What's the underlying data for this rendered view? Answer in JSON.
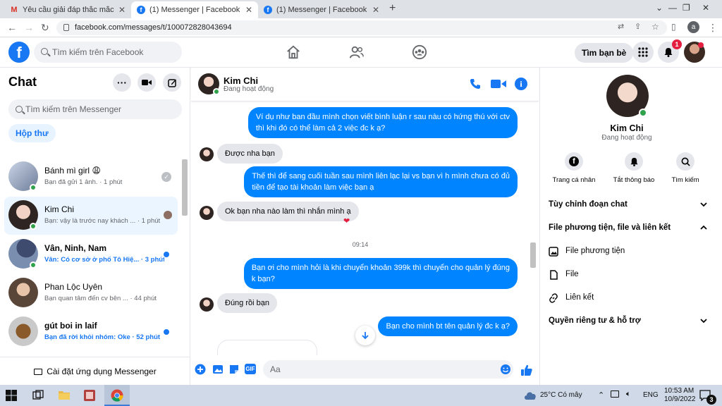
{
  "browser": {
    "tabs": [
      {
        "title": "Yêu cầu giải đáp thắc mắc - anhth",
        "icon": "gmail-icon",
        "active": false
      },
      {
        "title": "(1) Messenger | Facebook",
        "icon": "facebook-icon",
        "active": true
      },
      {
        "title": "(1) Messenger | Facebook",
        "icon": "facebook-icon",
        "active": false
      }
    ],
    "new_tab": "+",
    "url": "facebook.com/messages/t/100072828043694",
    "profile_initial": "a"
  },
  "fb_header": {
    "logo": "f",
    "search_placeholder": "Tìm kiếm trên Facebook",
    "find_friends": "Tìm bạn bè",
    "notification_count": "1"
  },
  "chats_panel": {
    "title": "Chat",
    "search_placeholder": "Tìm kiếm trên Messenger",
    "filter": "Hộp thư",
    "conversations": [
      {
        "name": "Bánh mì girl 😩",
        "preview": "Bạn đã gửi 1 ảnh.",
        "time": "1 phút",
        "selected": false,
        "unread": false,
        "online": true
      },
      {
        "name": "Kim Chi",
        "preview": "Bạn: vậy là trước nay khách ...",
        "time": "1 phút",
        "selected": true,
        "unread": false,
        "online": true
      },
      {
        "name": "Vân, Ninh, Nam",
        "preview": "Vân: Có cơ sở ở phố Tô Hiệ...",
        "time": "3 phút",
        "selected": false,
        "unread": true,
        "online": true
      },
      {
        "name": "Phan Lộc Uyên",
        "preview": "Bạn quan tâm đến cv bên ...",
        "time": "44 phút",
        "selected": false,
        "unread": false,
        "online": false
      },
      {
        "name": "gút boi in laif",
        "preview": "Bạn đã rời khỏi nhóm: Oke",
        "time": "52 phút",
        "selected": false,
        "unread": true,
        "online": false
      }
    ],
    "install": "Cài đặt ứng dụng Messenger"
  },
  "conversation": {
    "name": "Kim Chi",
    "status": "Đang hoạt động",
    "messages": [
      {
        "from": "me",
        "lines": [
          "Ví dụ như ban đầu mình chọn viết bình luận r sau nàu có hứng thú với ctv",
          "thì khi đó có thể làm cả 2 việc đc k ạ?"
        ]
      },
      {
        "from": "them",
        "lines": [
          "Được nha bạn"
        ]
      },
      {
        "from": "me",
        "lines": [
          "Thế thì để sang cuối tuần sau mình liên lạc lại vs bạn vì h mình chưa có đủ",
          "tiền để tạo tài khoản làm việc bạn ạ"
        ]
      },
      {
        "from": "them",
        "lines": [
          "Ok bạn nha nào làm thì nhắn mình ạ"
        ],
        "reaction": "❤"
      },
      {
        "type": "time",
        "text": "09:14"
      },
      {
        "from": "me",
        "lines": [
          "Bạn ơi cho mình hỏi là khi chuyển khoản 399k thì chuyển cho quản lý đúng",
          "k bạn?"
        ]
      },
      {
        "from": "them",
        "lines": [
          "Đúng rồi bạn"
        ]
      },
      {
        "from": "me",
        "lines": [
          "Bạn cho mình bt tên quản lý đc k ạ?"
        ]
      }
    ],
    "composer_placeholder": "Aa"
  },
  "profile_panel": {
    "name": "Kim Chi",
    "status": "Đang hoạt động",
    "actions": [
      {
        "label": "Trang cá nhân",
        "icon": "facebook-icon"
      },
      {
        "label": "Tắt thông báo",
        "icon": "bell-icon"
      },
      {
        "label": "Tìm kiếm",
        "icon": "search-icon"
      }
    ],
    "sections": [
      {
        "label": "Tùy chỉnh đoạn chat",
        "expanded": false
      },
      {
        "label": "File phương tiện, file và liên kết",
        "expanded": true
      },
      {
        "label": "Quyền riêng tư & hỗ trợ",
        "expanded": false
      }
    ],
    "sub_items": [
      {
        "label": "File phương tiện",
        "icon": "image-icon"
      },
      {
        "label": "File",
        "icon": "file-icon"
      },
      {
        "label": "Liên kết",
        "icon": "link-icon"
      }
    ]
  },
  "taskbar": {
    "weather": "25°C  Có mây",
    "language": "ENG",
    "time": "10:53 AM",
    "date": "10/9/2022",
    "notification_count": "3"
  },
  "colors": {
    "fb_blue": "#1877f2",
    "bubble_blue": "#0084ff",
    "online_green": "#31a24c"
  }
}
